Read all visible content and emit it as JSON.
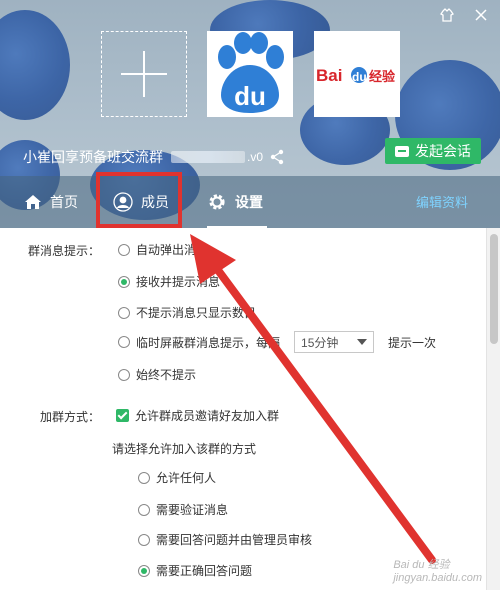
{
  "window": {
    "skin_icon": "skin-icon",
    "close_icon": "close-icon"
  },
  "header": {
    "add_avatar_icon": "plus-icon",
    "avatar1_text": "du",
    "avatar2_text_red": "Bai",
    "avatar2_text_blue": "du",
    "avatar2_text_suffix": "经验",
    "group_name": "小崔回享预备班交流群",
    "group_id_suffix": ".v0",
    "share_icon": "share-icon",
    "start_chat_label": "发起会话",
    "start_chat_color": "#2fb867"
  },
  "tabs": {
    "home_label": "首页",
    "member_label": "成员",
    "settings_label": "设置",
    "edit_profile_label": "编辑资料"
  },
  "settings": {
    "msg_section_label": "群消息提示：",
    "msg_options": [
      "自动弹出消息",
      "接收并提示消息",
      "不提示消息只显示数目",
      "临时屏蔽群消息提示，每隔",
      "始终不提示"
    ],
    "msg_selected_index": 1,
    "interval_value": "15分钟",
    "interval_suffix": "提示一次",
    "join_section_label": "加群方式：",
    "allow_invite_label": "允许群成员邀请好友加入群",
    "allow_invite_checked": true,
    "join_method_prompt": "请选择允许加入该群的方式",
    "join_options": [
      "允许任何人",
      "需要验证消息",
      "需要回答问题并由管理员审核",
      "需要正确回答问题"
    ],
    "join_selected_index": 3
  },
  "colors": {
    "annotation_red": "#e0332f",
    "accent_green": "#2fb867",
    "link_blue": "#7fd3ff"
  },
  "watermark": {
    "text": "Bai du 经验",
    "url": "jingyan.baidu.com"
  }
}
